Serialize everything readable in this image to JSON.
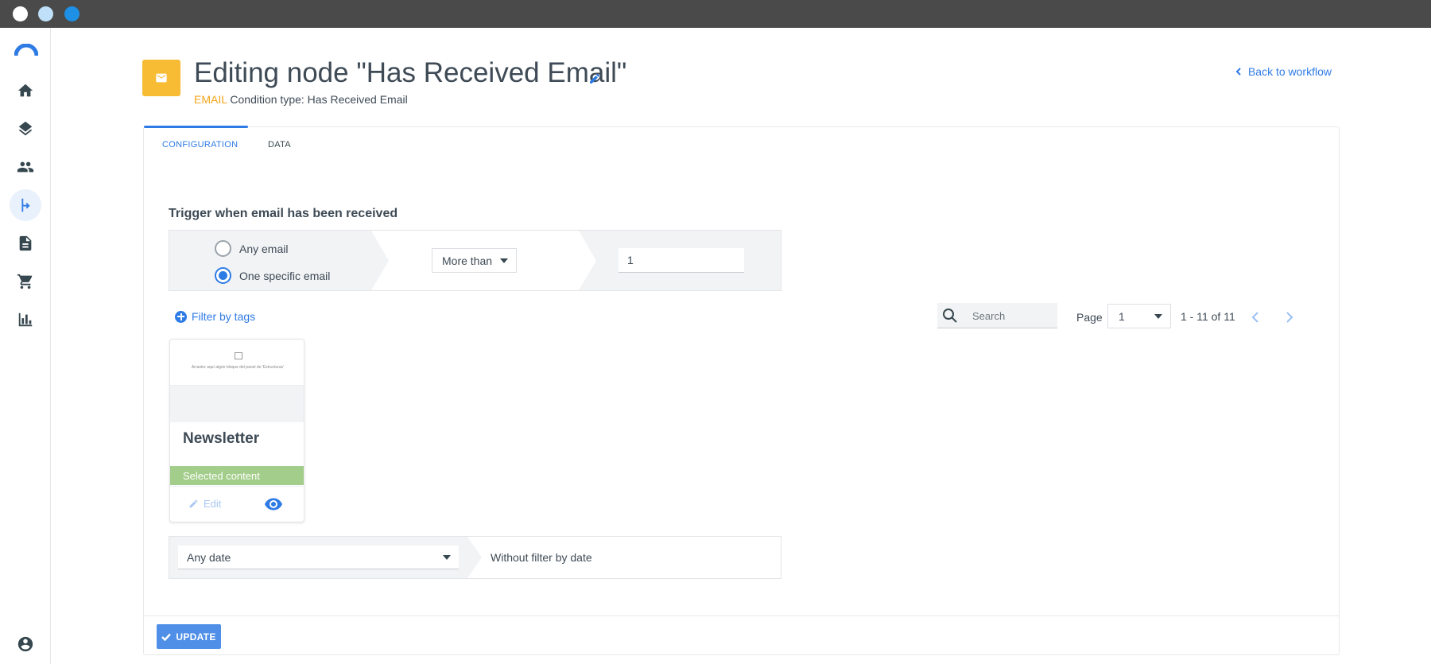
{
  "window": {
    "controls": [
      "close",
      "minimize",
      "maximize"
    ]
  },
  "sidebar": {
    "items": [
      {
        "name": "home",
        "icon": "home-icon"
      },
      {
        "name": "layers",
        "icon": "layers-icon"
      },
      {
        "name": "contacts",
        "icon": "people-icon"
      },
      {
        "name": "workflows",
        "icon": "workflow-icon",
        "active": true
      },
      {
        "name": "documents",
        "icon": "document-icon"
      },
      {
        "name": "shop",
        "icon": "cart-icon"
      },
      {
        "name": "reports",
        "icon": "bar-chart-icon"
      },
      {
        "name": "account",
        "icon": "account-icon"
      }
    ]
  },
  "header": {
    "title": "Editing node \"Has Received Email\"",
    "channel_tag": "EMAIL",
    "condition_text": "Condition type: Has Received Email",
    "back_link": "Back to workflow"
  },
  "tabs": [
    {
      "label": "CONFIGURATION",
      "active": true
    },
    {
      "label": "DATA",
      "active": false
    }
  ],
  "trigger": {
    "section_title": "Trigger when email has been received",
    "options": [
      {
        "label": "Any email",
        "selected": false
      },
      {
        "label": "One specific email",
        "selected": true
      }
    ],
    "comparison": "More than",
    "count": "1"
  },
  "filters": {
    "filter_tags_label": "Filter by tags",
    "search_placeholder": "Search",
    "page_label": "Page",
    "page_value": "1",
    "range_text": "1 - 11 of 11"
  },
  "template_card": {
    "preview_text": "Arrastre aquí algún bloque del panel de 'Estructuras'",
    "name": "Newsletter",
    "selected_label": "Selected content",
    "edit_label": "Edit"
  },
  "date_filter": {
    "selected": "Any date",
    "description": "Without filter by date"
  },
  "footer": {
    "update_label": "UPDATE"
  },
  "colors": {
    "accent": "#2f7be5",
    "email_badge": "#f7bc33",
    "email_tag": "#f2a51a",
    "selected_content": "#a3cd8a",
    "update_button": "#4f8fe8"
  }
}
